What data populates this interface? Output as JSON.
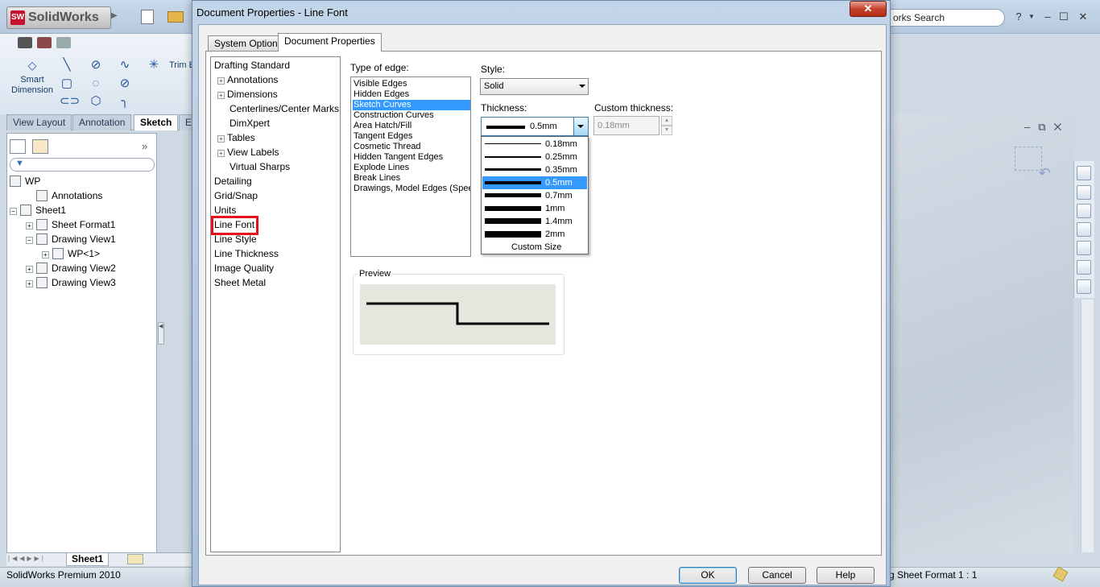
{
  "app": {
    "logo_text": "SolidWorks",
    "logo_badge": "SW",
    "search_text": "orks Search",
    "help_glyph": "?",
    "cmd": {
      "smart_dimension": "Smart Dimension",
      "trim": "Trim Entities"
    },
    "tabs": [
      "View Layout",
      "Annotation",
      "Sketch",
      "E"
    ],
    "tree": {
      "root": "WP",
      "items": [
        {
          "label": "Annotations",
          "indent": 1,
          "exp": ""
        },
        {
          "label": "Sheet1",
          "indent": 0,
          "exp": "−"
        },
        {
          "label": "Sheet Format1",
          "indent": 1,
          "exp": "+"
        },
        {
          "label": "Drawing View1",
          "indent": 1,
          "exp": "−"
        },
        {
          "label": "WP<1>",
          "indent": 2,
          "exp": "+"
        },
        {
          "label": "Drawing View2",
          "indent": 1,
          "exp": "+"
        },
        {
          "label": "Drawing View3",
          "indent": 1,
          "exp": "+"
        }
      ]
    },
    "sheet_tab": "Sheet1",
    "status_left": "SolidWorks Premium 2010",
    "status_right": "g Sheet Format   1 : 1"
  },
  "dialog": {
    "title": "Document Properties - Line Font",
    "close": "✕",
    "tabs": [
      "System Options",
      "Document Properties"
    ],
    "categories": [
      {
        "label": "Drafting Standard",
        "level": 0,
        "exp": false
      },
      {
        "label": "Annotations",
        "level": 1,
        "exp": true
      },
      {
        "label": "Dimensions",
        "level": 1,
        "exp": true
      },
      {
        "label": "Centerlines/Center Marks",
        "level": 1,
        "exp": false
      },
      {
        "label": "DimXpert",
        "level": 1,
        "exp": false
      },
      {
        "label": "Tables",
        "level": 1,
        "exp": true
      },
      {
        "label": "View Labels",
        "level": 1,
        "exp": true
      },
      {
        "label": "Virtual Sharps",
        "level": 1,
        "exp": false
      },
      {
        "label": "Detailing",
        "level": 0,
        "exp": false
      },
      {
        "label": "Grid/Snap",
        "level": 0,
        "exp": false
      },
      {
        "label": "Units",
        "level": 0,
        "exp": false
      },
      {
        "label": "Line Font",
        "level": 0,
        "exp": false
      },
      {
        "label": "Line Style",
        "level": 0,
        "exp": false
      },
      {
        "label": "Line Thickness",
        "level": 0,
        "exp": false
      },
      {
        "label": "Image Quality",
        "level": 0,
        "exp": false
      },
      {
        "label": "Sheet Metal",
        "level": 0,
        "exp": false
      }
    ],
    "type_of_edge_label": "Type of edge:",
    "edges": [
      "Visible Edges",
      "Hidden Edges",
      "Sketch Curves",
      "Construction Curves",
      "Area Hatch/Fill",
      "Tangent Edges",
      "Cosmetic Thread",
      "Hidden Tangent Edges",
      "Explode Lines",
      "Break Lines",
      "Drawings, Model Edges (Speedpak)"
    ],
    "selected_edge": 2,
    "style_label": "Style:",
    "style_value": "Solid",
    "thickness_label": "Thickness:",
    "thickness_value": "0.5mm",
    "custom_thickness_label": "Custom thickness:",
    "custom_thickness_value": "0.18mm",
    "thickness_options": [
      {
        "label": "0.18mm",
        "w": 1
      },
      {
        "label": "0.25mm",
        "w": 2
      },
      {
        "label": "0.35mm",
        "w": 3
      },
      {
        "label": "0.5mm",
        "w": 4
      },
      {
        "label": "0.7mm",
        "w": 5
      },
      {
        "label": "1mm",
        "w": 6
      },
      {
        "label": "1.4mm",
        "w": 7
      },
      {
        "label": "2mm",
        "w": 8
      }
    ],
    "selected_thickness": 3,
    "custom_size": "Custom Size",
    "preview_label": "Preview",
    "buttons": {
      "ok": "OK",
      "cancel": "Cancel",
      "help": "Help"
    }
  }
}
